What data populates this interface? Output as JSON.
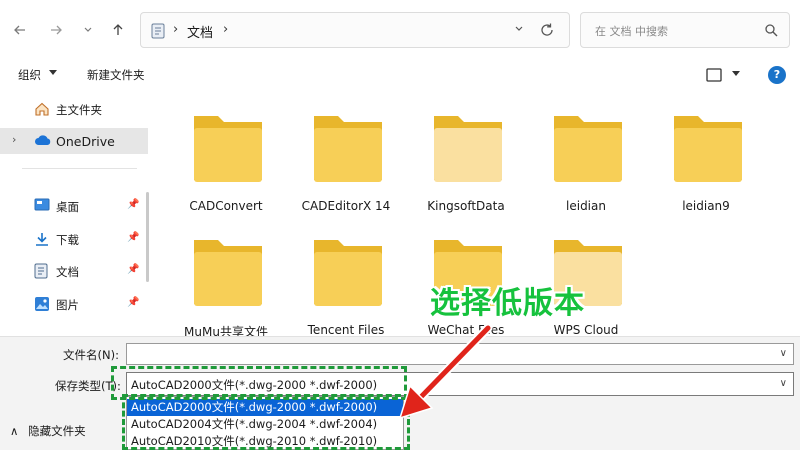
{
  "nav": {
    "breadcrumb_sep": "›",
    "breadcrumb_current": "文档",
    "search_placeholder": "在 文档 中搜索"
  },
  "toolbar": {
    "organize_label": "组织",
    "new_folder_label": "新建文件夹",
    "help_label": "?"
  },
  "sidebar": {
    "items": [
      {
        "label": "主文件夹",
        "icon": "home-icon"
      },
      {
        "label": "OneDrive",
        "icon": "cloud-icon"
      },
      {
        "label": "桌面",
        "icon": "desktop-icon"
      },
      {
        "label": "下载",
        "icon": "download-icon"
      },
      {
        "label": "文档",
        "icon": "document-icon"
      },
      {
        "label": "图片",
        "icon": "pictures-icon"
      }
    ]
  },
  "folders": [
    {
      "name": "CADConvert"
    },
    {
      "name": "CADEditorX 14"
    },
    {
      "name": "KingsoftData"
    },
    {
      "name": "leidian"
    },
    {
      "name": "leidian9"
    },
    {
      "name": "MuMu共享文件"
    },
    {
      "name": "Tencent Files"
    },
    {
      "name": "WeChat Files"
    },
    {
      "name": "WPS Cloud"
    }
  ],
  "save": {
    "filename_label": "文件名(N):",
    "filename_value": "",
    "type_label": "保存类型(T):",
    "type_value": "AutoCAD2000文件(*.dwg-2000 *.dwf-2000)",
    "type_options": [
      "AutoCAD2000文件(*.dwg-2000 *.dwf-2000)",
      "AutoCAD2004文件(*.dwg-2004 *.dwf-2004)",
      "AutoCAD2010文件(*.dwg-2010 *.dwf-2010)"
    ],
    "hide_folders_label": "隐藏文件夹"
  },
  "annotation": {
    "text": "选择低版本",
    "color": "#16c23d",
    "arrow_color": "#e0241b"
  },
  "colors": {
    "folder_body": "#f7cf57",
    "folder_tab": "#e8b62c",
    "selection": "#0a64d6",
    "annotation_box": "#1f9a3a"
  }
}
